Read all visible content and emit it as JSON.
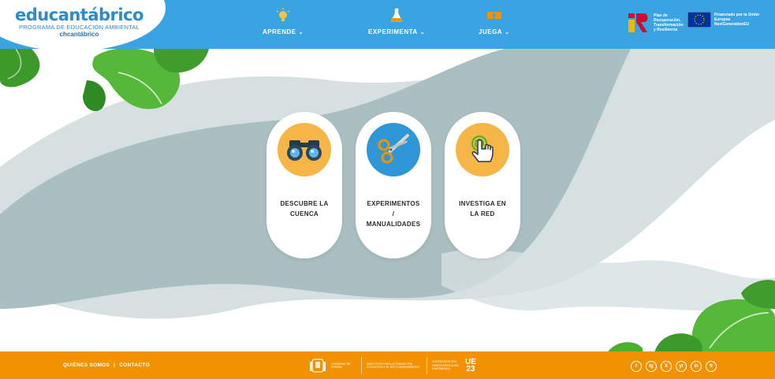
{
  "brand": {
    "title": "educantábrico",
    "subtitle": "PROGRAMA DE EDUCACIÓN AMBIENTAL",
    "org": "chcantábrico"
  },
  "nav": {
    "items": [
      {
        "label": "APRENDE",
        "icon": "lightbulb-icon"
      },
      {
        "label": "EXPERIMENTA",
        "icon": "flask-icon"
      },
      {
        "label": "JUEGA",
        "icon": "puzzle-icon"
      }
    ]
  },
  "funding": {
    "plan_text": "Plan de Recuperación, Transformación y Resiliencia",
    "eu_text": "Financiado por la Unión Europea NextGenerationEU"
  },
  "cards": [
    {
      "label_lines": [
        "DESCUBRE LA",
        "CUENCA"
      ],
      "icon": "binoculars-icon",
      "color": "#f5b547"
    },
    {
      "label_lines": [
        "EXPERIMENTOS",
        "/",
        "MANUALIDADES"
      ],
      "icon": "scissors-icon",
      "color": "#2f97d6"
    },
    {
      "label_lines": [
        "INVESTIGA EN",
        "LA RED"
      ],
      "icon": "pointer-hand-icon",
      "color": "#f5b547"
    }
  ],
  "footer": {
    "about": "QUIÉNES SOMOS",
    "separator": "|",
    "contact": "CONTACTO",
    "gov_text": "GOBIERNO DE ESPAÑA",
    "ministry_text": "MINISTERIO PARA LA TRANSICIÓN ECOLÓGICA Y EL RETO DEMOGRÁFICO",
    "agency_text": "CONFEDERACIÓN HIDROGRÁFICA DEL CANTÁBRICO",
    "ue23_line1": "UE",
    "ue23_line2": "23",
    "social": [
      "f",
      "ig",
      "X",
      "yt",
      "in",
      "fl"
    ]
  },
  "colors": {
    "header": "#3aa3e2",
    "footer": "#f39200",
    "leaf_green": "#4caf2e",
    "wave_gray": "#a9bfc2"
  }
}
